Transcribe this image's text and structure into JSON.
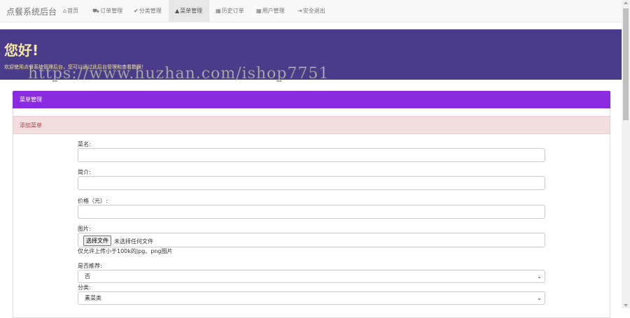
{
  "navbar": {
    "brand": "点餐系统后台",
    "items": [
      {
        "icon": "home-icon",
        "glyph": "⌂",
        "label": "首页"
      },
      {
        "icon": "cart-icon",
        "glyph": "⛟",
        "label": "订单管理"
      },
      {
        "icon": "check-icon",
        "glyph": "✔",
        "label": "分类管理"
      },
      {
        "icon": "user-icon",
        "glyph": "▲",
        "label": "菜单管理"
      },
      {
        "icon": "grid-icon",
        "glyph": "▦",
        "label": "历史订单"
      },
      {
        "icon": "grid-icon",
        "glyph": "▦",
        "label": "用户管理"
      },
      {
        "icon": "logout-icon",
        "glyph": "⇥",
        "label": "安全退出"
      }
    ]
  },
  "jumbotron": {
    "title": "您好!",
    "subtitle": "欢迎使用点餐系统管理后台，您可以通过此后台管理和查看数据！"
  },
  "watermark": "https://www.huzhan.com/ishop7751",
  "panel": {
    "title": "菜单管理",
    "sub_title": "添加菜单"
  },
  "form": {
    "name_label": "菜名:",
    "intro_label": "简介:",
    "price_label": "价格（元）:",
    "image_label": "图片:",
    "file_button": "选择文件",
    "file_status": "未选择任何文件",
    "image_help": "仅允许上传小于100k的jpg、png图片",
    "recommend_label": "是否推荐:",
    "recommend_value": "否",
    "category_label": "分类:",
    "category_value": "素菜类"
  },
  "colors": {
    "jumbotron_bg": "#4b3b8b",
    "jumbotron_text": "#f3e6a2",
    "panel_head": "#8a2be2",
    "sub_head_bg": "#f2dede",
    "sub_head_text": "#a94442"
  }
}
